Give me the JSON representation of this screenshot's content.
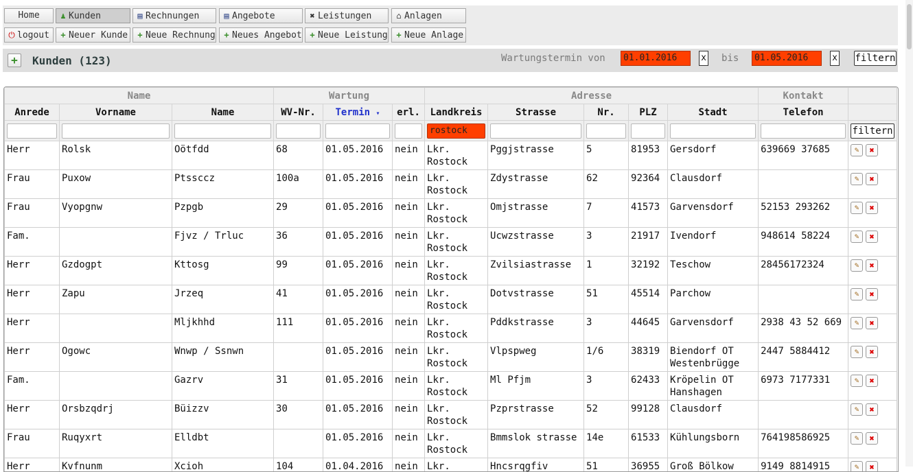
{
  "menu": {
    "row1": [
      {
        "label": "Home",
        "icon": "",
        "name": "nav-home"
      },
      {
        "label": "Kunden",
        "icon": "user-icon",
        "name": "nav-kunden",
        "active": true
      },
      {
        "label": "Rechnungen",
        "icon": "document-icon",
        "name": "nav-rechnungen"
      },
      {
        "label": "Angebote",
        "icon": "document-icon",
        "name": "nav-angebote"
      },
      {
        "label": "Leistungen",
        "icon": "tools-icon",
        "name": "nav-leistungen"
      },
      {
        "label": "Anlagen",
        "icon": "building-icon",
        "name": "nav-anlagen"
      }
    ],
    "row2": [
      {
        "label": "logout",
        "icon": "power-icon",
        "name": "logout-button"
      },
      {
        "label": "Neuer Kunde",
        "icon": "plus-icon",
        "name": "new-customer-button"
      },
      {
        "label": "Neue Rechnung",
        "icon": "plus-icon",
        "name": "new-invoice-button"
      },
      {
        "label": "Neues Angebot",
        "icon": "plus-icon",
        "name": "new-offer-button"
      },
      {
        "label": "Neue Leistung",
        "icon": "plus-icon",
        "name": "new-service-button"
      },
      {
        "label": "Neue Anlage",
        "icon": "plus-icon",
        "name": "new-system-button"
      }
    ]
  },
  "toolbar": {
    "title": "Kunden (123)",
    "wartung_von_label": "Wartungstermin von",
    "von_value": "01.01.2016",
    "bis_label": "bis",
    "bis_value": "01.05.2016",
    "clear_label": "x",
    "filter_label": "filtern"
  },
  "table": {
    "groups": [
      "Name",
      "Wartung",
      "Adresse",
      "Kontakt",
      ""
    ],
    "columns": [
      "Anrede",
      "Vorname",
      "Name",
      "WV-Nr.",
      "Termin",
      "erl.",
      "Landkreis",
      "Strasse",
      "Nr.",
      "PLZ",
      "Stadt",
      "Telefon"
    ],
    "sort_indicator": "▾",
    "filter_values": [
      "",
      "",
      "",
      "",
      "",
      "",
      "rostock",
      "",
      "",
      "",
      "",
      ""
    ],
    "filter_button": "filtern",
    "rows": [
      [
        "Herr",
        "Rolsk",
        "Oötfdd",
        "68",
        "01.05.2016",
        "nein",
        "Lkr. Rostock",
        "Pggjstrasse",
        "5",
        "81953",
        "Gersdorf",
        "639669 37685"
      ],
      [
        "Frau",
        "Puxow",
        "Ptssccz",
        "100a",
        "01.05.2016",
        "nein",
        "Lkr. Rostock",
        "Zdystrasse",
        "62",
        "92364",
        "Clausdorf",
        ""
      ],
      [
        "Frau",
        "Vyopgnw",
        "Pzpgb",
        "29",
        "01.05.2016",
        "nein",
        "Lkr. Rostock",
        "Omjstrasse",
        "7",
        "41573",
        "Garvensdorf",
        "52153 293262"
      ],
      [
        "Fam.",
        "",
        "Fjvz / Trluc",
        "36",
        "01.05.2016",
        "nein",
        "Lkr. Rostock",
        "Ucwzstrasse",
        "3",
        "21917",
        "Ivendorf",
        "948614 58224"
      ],
      [
        "Herr",
        "Gzdogpt",
        "Kttosg",
        "99",
        "01.05.2016",
        "nein",
        "Lkr. Rostock",
        "Zvilsiastrasse",
        "1",
        "32192",
        "Teschow",
        "28456172324"
      ],
      [
        "Herr",
        "Zapu",
        "Jrzeq",
        "41",
        "01.05.2016",
        "nein",
        "Lkr. Rostock",
        "Dotvstrasse",
        "51",
        "45514",
        "Parchow",
        ""
      ],
      [
        "Herr",
        "",
        "Mljkhhd",
        "111",
        "01.05.2016",
        "nein",
        "Lkr. Rostock",
        "Pddkstrasse",
        "3",
        "44645",
        "Garvensdorf",
        "2938 43 52 669"
      ],
      [
        "Herr",
        "Ogowc",
        "Wnwp / Ssnwn",
        "",
        "01.05.2016",
        "nein",
        "Lkr. Rostock",
        "Vlpspweg",
        "1/6",
        "38319",
        "Biendorf OT Westenbrügge",
        "2447 5884412"
      ],
      [
        "Fam.",
        "",
        "Gazrv",
        "31",
        "01.05.2016",
        "nein",
        "Lkr. Rostock",
        "Ml Pfjm",
        "3",
        "62433",
        "Kröpelin OT Hanshagen",
        "6973 7177331"
      ],
      [
        "Herr",
        "Orsbzqdrj",
        "Büizzv",
        "30",
        "01.05.2016",
        "nein",
        "Lkr. Rostock",
        "Pzprstrasse",
        "52",
        "99128",
        "Clausdorf",
        ""
      ],
      [
        "Frau",
        "Ruqyxrt",
        "Elldbt",
        "",
        "01.05.2016",
        "nein",
        "Lkr. Rostock",
        "Bmmslok strasse",
        "14e",
        "61533",
        "Kühlungsborn",
        "764198586925"
      ],
      [
        "Herr",
        "Kvfnunm",
        "Xcioh",
        "104",
        "01.04.2016",
        "nein",
        "Lkr. Rostock",
        "Hncsrqgfiv",
        "51",
        "36955",
        "Groß Bölkow",
        "9149 8814915"
      ]
    ]
  }
}
